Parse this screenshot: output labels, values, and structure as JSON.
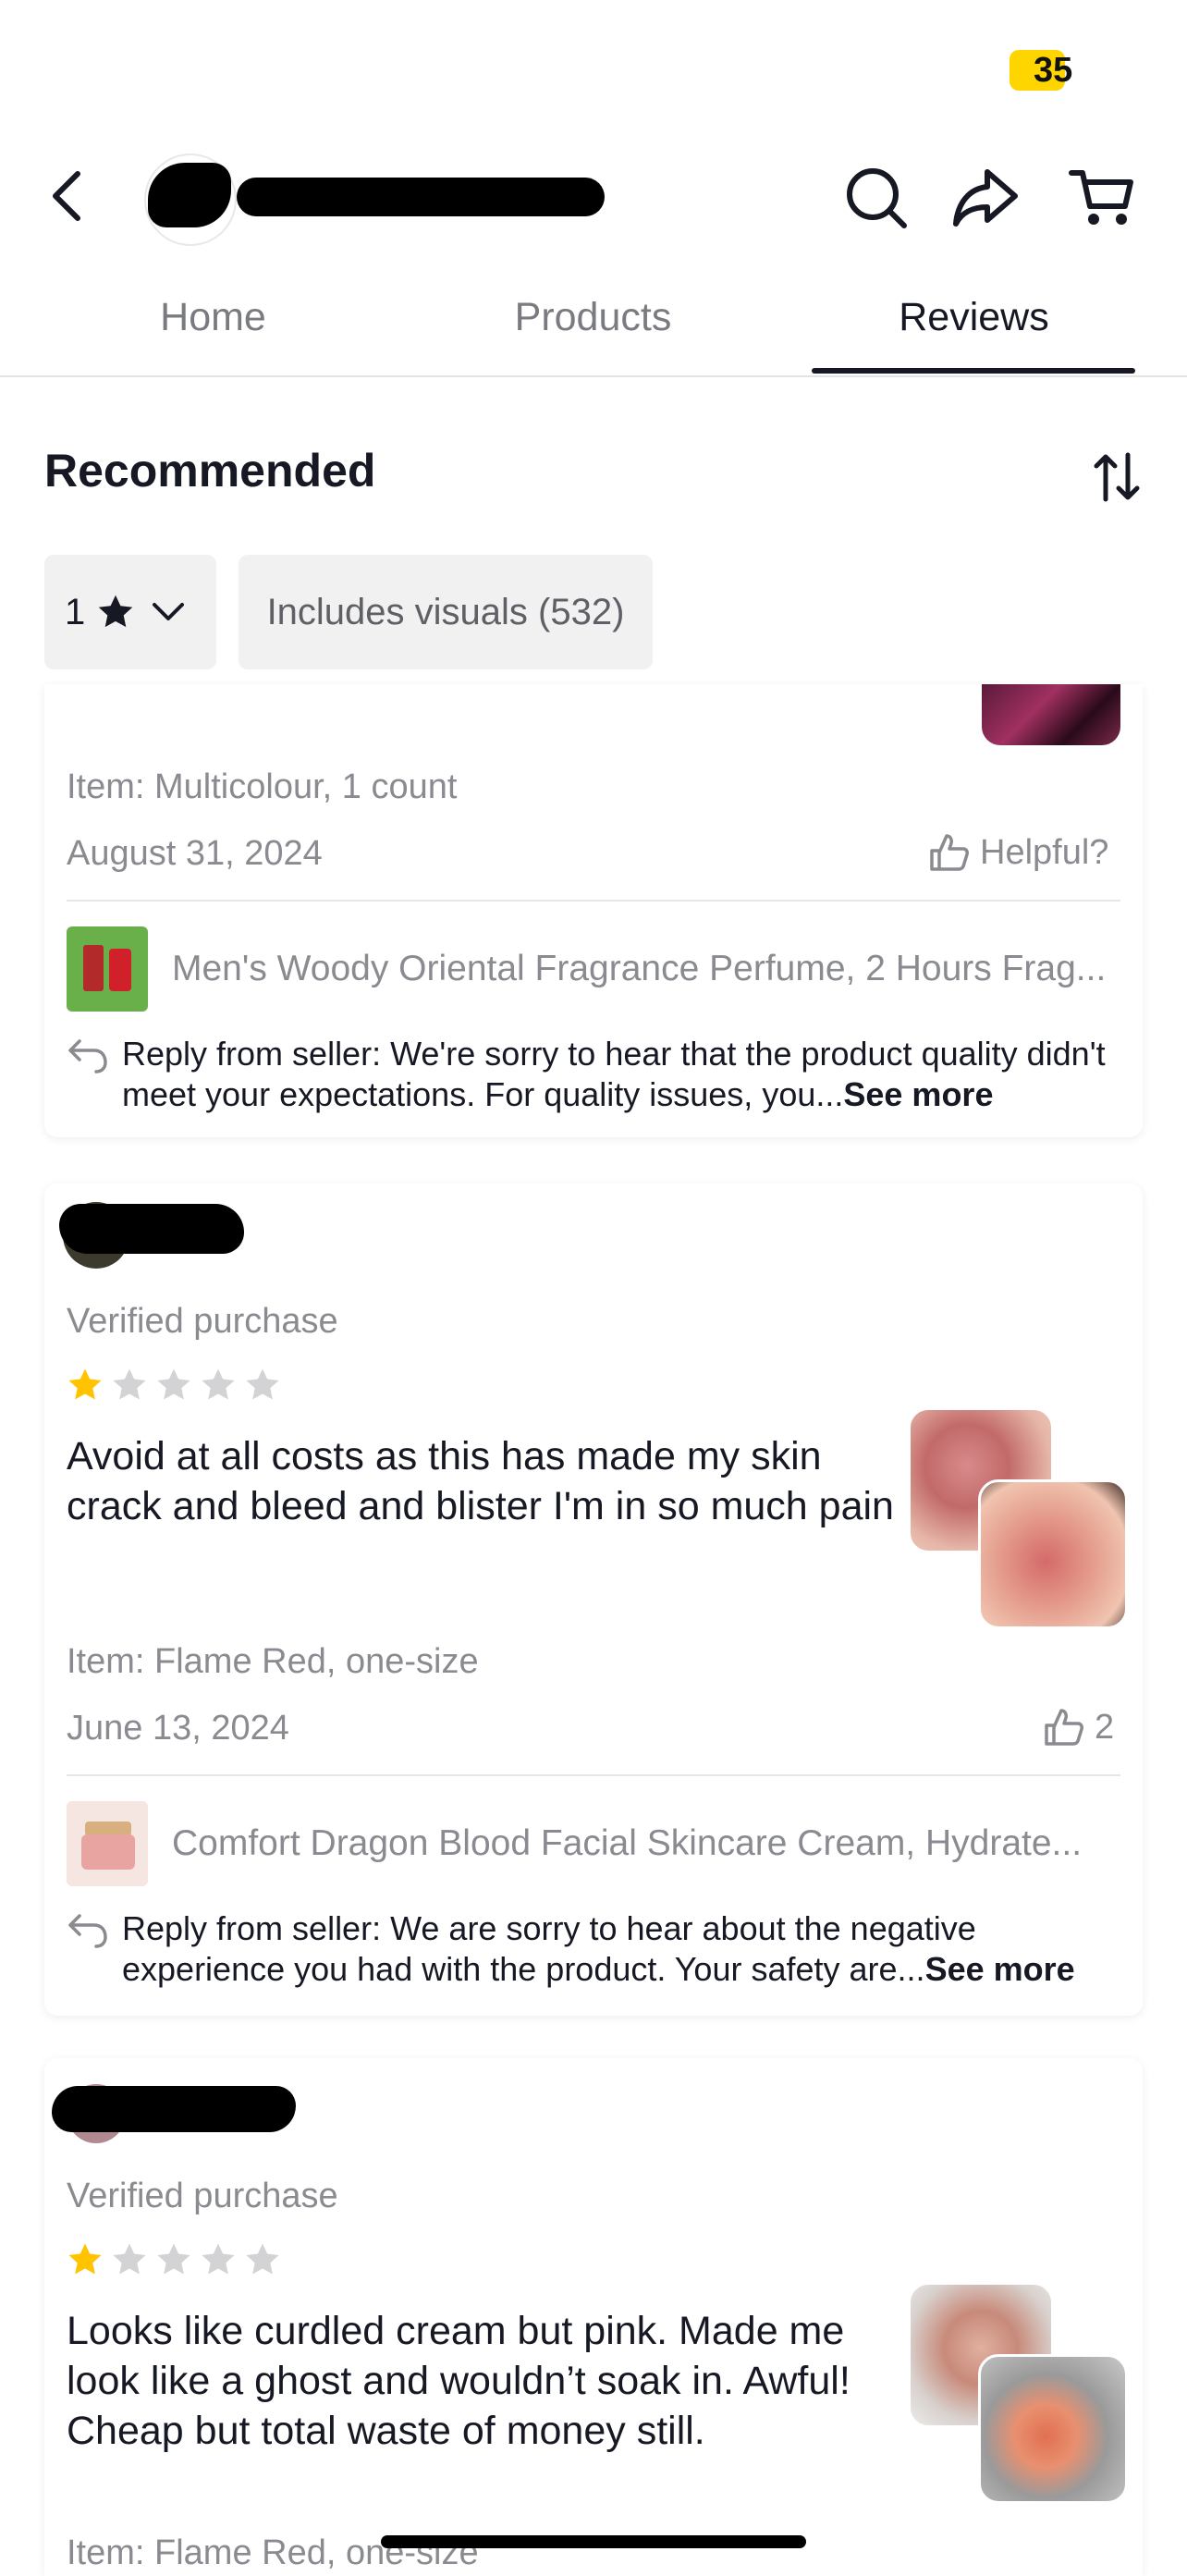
{
  "status": {
    "badge": "35"
  },
  "header": {
    "back_icon": "back-chevron-icon",
    "search_icon": "search-icon",
    "share_icon": "share-icon",
    "cart_icon": "cart-icon"
  },
  "tabs": [
    {
      "label": "Home"
    },
    {
      "label": "Products"
    },
    {
      "label": "Reviews"
    }
  ],
  "section": {
    "title": "Recommended",
    "sort_icon": "sort-arrows-icon"
  },
  "filters": {
    "rating": {
      "value": "1"
    },
    "visuals": {
      "label": "Includes visuals (532)"
    }
  },
  "reviews": [
    {
      "item": "Item: Multicolour, 1 count",
      "date": "August 31, 2024",
      "helpful": "Helpful?",
      "product": "Men's Woody Oriental Fragrance Perfume, 2 Hours Frag...",
      "reply": "Reply from seller: We're sorry to hear that the product quality didn't meet your expectations. For quality issues, you...",
      "see_more": "See more"
    },
    {
      "verified": "Verified purchase",
      "rating": 1,
      "body": "Avoid at all costs as this has made my skin crack and bleed and blister I'm in so much pain",
      "item": "Item: Flame Red, one-size",
      "date": "June 13, 2024",
      "helpful": "2",
      "product": "Comfort Dragon Blood Facial Skincare Cream, Hydrate...",
      "reply": "Reply from seller: We are sorry to hear about the negative experience you had with the product. Your safety are...",
      "see_more": "See more"
    },
    {
      "verified": "Verified purchase",
      "rating": 1,
      "body": "Looks like curdled cream but pink. Made me look like a ghost and wouldn’t soak in. Awful!  Cheap but total waste of money still.",
      "item": "Item: Flame Red, one-size"
    }
  ],
  "colors": {
    "star_active": "#FFC300",
    "star_inactive": "#D3D3D6",
    "badge": "#FFD500"
  }
}
